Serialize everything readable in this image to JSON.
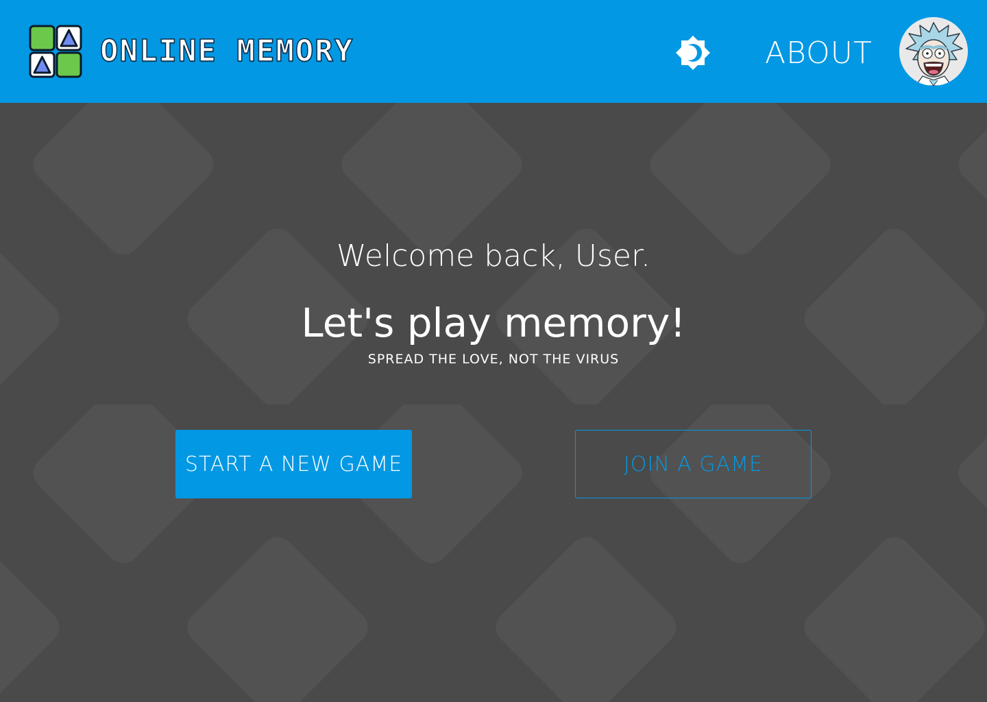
{
  "header": {
    "brand": "ONLINE MEMORY",
    "about_label": "ABOUT",
    "theme_icon": "brightness-icon",
    "logo_icon": "memory-cards-logo"
  },
  "main": {
    "welcome": "Welcome back, User.",
    "headline": "Let's play memory!",
    "tagline": "SPREAD THE LOVE, NOT THE VIRUS",
    "start_button": "START A NEW GAME",
    "join_button": "JOIN A GAME"
  },
  "colors": {
    "accent": "#0398e3",
    "background": "#4a4a4a",
    "pattern": "#525252",
    "logo_green": "#6cc84b",
    "logo_triangle": "#6e8cf2"
  }
}
